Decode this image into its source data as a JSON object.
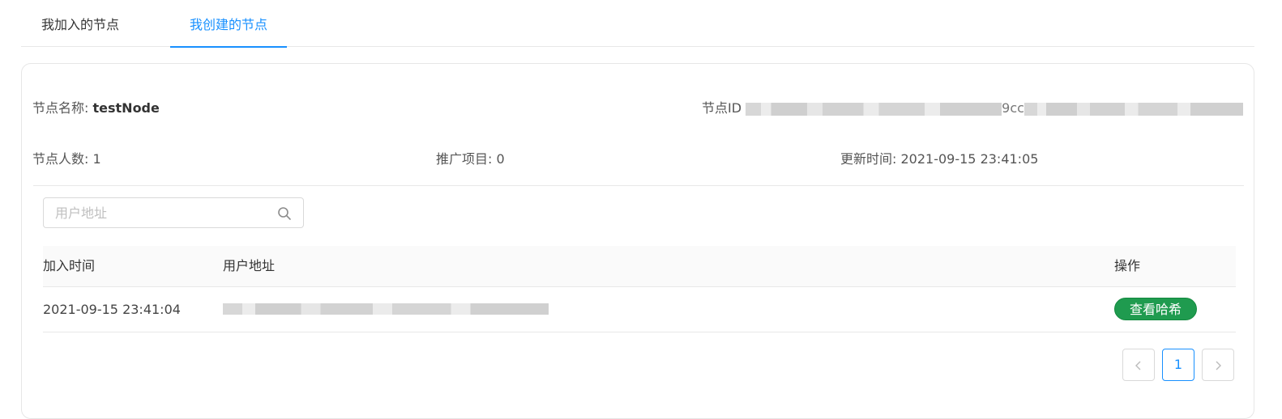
{
  "tabs": [
    {
      "label": "我加入的节点",
      "active": false
    },
    {
      "label": "我创建的节点",
      "active": true
    }
  ],
  "node": {
    "name_label": "节点名称:",
    "name_value": "testNode",
    "id_label": "节点ID",
    "id_fragment": "9cc",
    "members_label": "节点人数:",
    "members_value": "1",
    "projects_label": "推广项目:",
    "projects_value": "0",
    "updated_label": "更新时间:",
    "updated_value": "2021-09-15 23:41:05"
  },
  "search": {
    "placeholder": "用户地址",
    "icon": "search-icon"
  },
  "table": {
    "columns": [
      "加入时间",
      "用户地址",
      "操作"
    ],
    "rows": [
      {
        "join_time": "2021-09-15 23:41:04",
        "action_label": "查看哈希"
      }
    ]
  },
  "pagination": {
    "prev_icon": "chevron-left-icon",
    "current_page": "1",
    "next_icon": "chevron-right-icon"
  },
  "colors": {
    "accent": "#1890ff",
    "action_button": "#1f9b4f"
  }
}
